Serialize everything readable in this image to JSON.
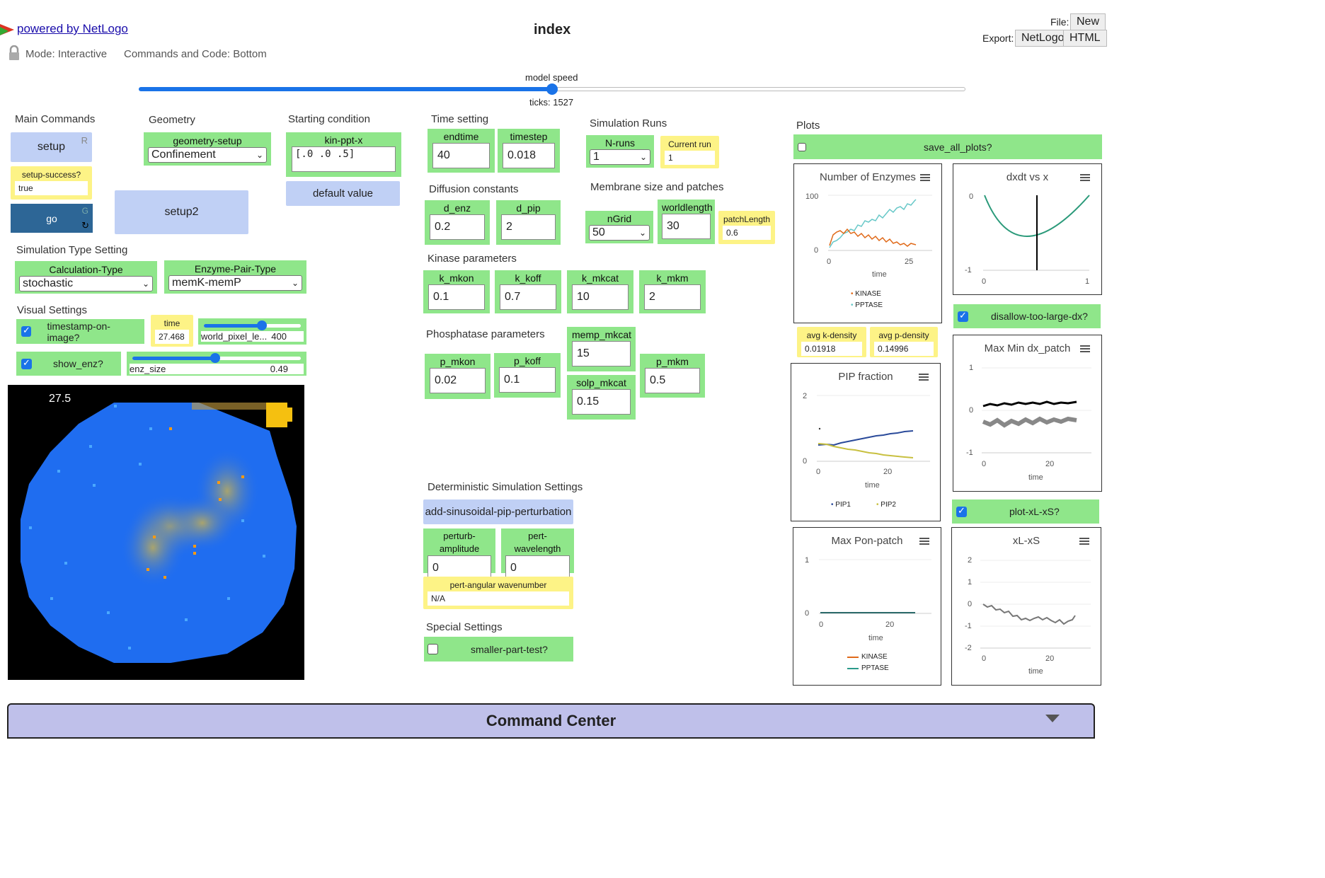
{
  "header": {
    "powered_by": "powered by NetLogo",
    "title": "index",
    "mode": "Mode: Interactive",
    "commands_code": "Commands and Code: Bottom",
    "file_label": "File:",
    "file_new": "New",
    "export_label": "Export:",
    "export_netlogo": "NetLogo",
    "export_html": "HTML"
  },
  "speed": {
    "label": "model speed",
    "ticks": "ticks: 1527",
    "value": 0.5
  },
  "main_commands": {
    "title": "Main Commands",
    "setup": "setup",
    "setup_key": "R",
    "setup_success_label": "setup-success?",
    "setup_success_value": "true",
    "go": "go",
    "go_key": "G",
    "setup2": "setup2"
  },
  "geometry": {
    "title": "Geometry",
    "label": "geometry-setup",
    "value": "Confinement"
  },
  "starting": {
    "title": "Starting condition",
    "label": "kin-ppt-x",
    "value": "[.0 .0 .5]",
    "default_button": "default value"
  },
  "sim_type": {
    "title": "Simulation Type Setting",
    "calc_label": "Calculation-Type",
    "calc_value": "stochastic",
    "enz_label": "Enzyme-Pair-Type",
    "enz_value": "memK-memP"
  },
  "visual": {
    "title": "Visual Settings",
    "timestamp": "timestamp-on-image?",
    "time_label": "time",
    "time_value": "27.468",
    "wpl_label": "world_pixel_le...",
    "wpl_value": "400",
    "wpl_fraction": 0.6,
    "show_enz": "show_enz?",
    "enz_size_label": "enz_size",
    "enz_size_value": "0.49",
    "enz_size_fraction": 0.49
  },
  "view": {
    "timestamp": "27.5"
  },
  "time_setting": {
    "title": "Time setting",
    "endtime_label": "endtime",
    "endtime_value": "40",
    "timestep_label": "timestep",
    "timestep_value": "0.018"
  },
  "sim_runs": {
    "title": "Simulation Runs",
    "nruns_label": "N-runs",
    "nruns_value": "1",
    "current_label": "Current run",
    "current_value": "1"
  },
  "diffusion": {
    "title": "Diffusion constants",
    "denz_label": "d_enz",
    "denz_value": "0.2",
    "dpip_label": "d_pip",
    "dpip_value": "2"
  },
  "membrane": {
    "title": "Membrane size and patches",
    "ngrid_label": "nGrid",
    "ngrid_value": "50",
    "wl_label": "worldlength",
    "wl_value": "30",
    "patch_label": "patchLength",
    "patch_value": "0.6"
  },
  "kinase": {
    "title": "Kinase parameters",
    "items": [
      {
        "label": "k_mkon",
        "value": "0.1"
      },
      {
        "label": "k_koff",
        "value": "0.7"
      },
      {
        "label": "k_mkcat",
        "value": "10"
      },
      {
        "label": "k_mkm",
        "value": "2"
      }
    ]
  },
  "phosphatase": {
    "title": "Phosphatase parameters",
    "pmkon_label": "p_mkon",
    "pmkon_value": "0.02",
    "pkoff_label": "p_koff",
    "pkoff_value": "0.1",
    "memp_label": "memp_mkcat",
    "memp_value": "15",
    "solp_label": "solp_mkcat",
    "solp_value": "0.15",
    "pmkm_label": "p_mkm",
    "pmkm_value": "0.5"
  },
  "deterministic": {
    "title": "Deterministic Simulation Settings",
    "button": "add-sinusoidal-pip-perturbation",
    "amp_label": "perturb-amplitude",
    "amp_value": "0",
    "wl_label": "pert-wavelength",
    "wl_value": "0",
    "ang_label": "pert-angular wavenumber",
    "ang_value": "N/A"
  },
  "special": {
    "title": "Special Settings",
    "label": "smaller-part-test?"
  },
  "plots": {
    "title": "Plots",
    "save_all": "save_all_plots?",
    "disallow": "disallow-too-large-dx?",
    "plot_xl": "plot-xL-xS?",
    "avgk_label": "avg k-density",
    "avgk_value": "0.01918",
    "avgp_label": "avg p-density",
    "avgp_value": "0.14996",
    "enzymes": {
      "title": "Number of Enzymes",
      "xlabel": "time",
      "y_top": "100",
      "y_bottom": "0",
      "x_left": "0",
      "x_right": "25",
      "legend1": "KINASE",
      "legend2": "PPTASE"
    },
    "dxdt": {
      "title": "dxdt vs x",
      "y_top": "0",
      "y_bottom": "-1",
      "x_left": "0",
      "x_right": "1"
    },
    "pip": {
      "title": "PIP fraction",
      "xlabel": "time",
      "y_top": "2",
      "y_bottom": "0",
      "x_left": "0",
      "x_right": "20",
      "legend1": "PIP1",
      "legend2": "PIP2"
    },
    "maxmin": {
      "title": "Max Min dx_patch",
      "xlabel": "time",
      "y_top": "1",
      "y_mid": "0",
      "y_bottom": "-1",
      "x_left": "0",
      "x_right": "20"
    },
    "maxpon": {
      "title": "Max Pon-patch",
      "xlabel": "time",
      "y_top": "1",
      "y_bottom": "0",
      "x_left": "0",
      "x_right": "20",
      "legend1": "KINASE",
      "legend2": "PPTASE"
    },
    "xlxs": {
      "title": "xL-xS",
      "xlabel": "time",
      "y1": "2",
      "y2": "1",
      "y3": "0",
      "y4": "-1",
      "y5": "-2",
      "x_left": "0",
      "x_right": "20"
    }
  },
  "command_center": {
    "title": "Command Center"
  },
  "colors": {
    "green": "#8fe68a",
    "yellow": "#fdf386",
    "blue_button": "#c0d0f5",
    "go_button": "#2d6696",
    "kinase": "#e06a1a",
    "pptase": "#2b9a8a",
    "pip1": "#2a4a9a",
    "pip2": "#c8c040"
  }
}
